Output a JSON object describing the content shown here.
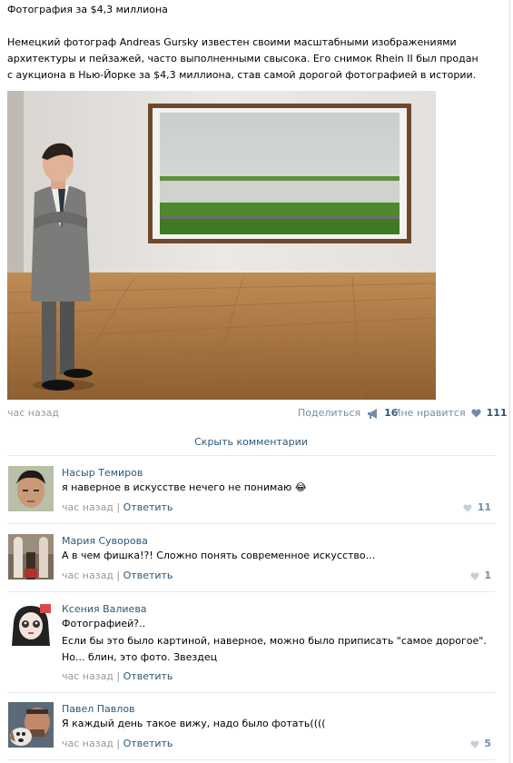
{
  "post": {
    "title": "Фотография за $4,3 миллиона",
    "text": "Немецкий фотограф Andreas Gursky известен своими масштабными изображениями архитектуры и пейзажей, часто выполненными свысока. Его снимок Rhein II был продан с аукциона в Нью-Йорке за $4,3 миллиона, став самой дорогой фотографией в истории.",
    "time": "час назад",
    "share_label": "Поделиться",
    "share_count": "16",
    "like_label": "Мне нравится",
    "like_count": "111",
    "hide_comments": "Скрыть комментарии"
  },
  "comments": [
    {
      "author": "Насыр Темиров",
      "text": "я наверное в искусстве нечего не понимаю",
      "emoji": "😂",
      "time": "час назад",
      "reply": "Ответить",
      "likes": "11"
    },
    {
      "author": "Мария Суворова",
      "text": "А в чем фишка!?! Сложно понять современное искусство...",
      "time": "час назад",
      "reply": "Ответить",
      "likes": "1"
    },
    {
      "author": "Ксения Валиева",
      "text_line1": "Фотографией?..",
      "text_line2": "Если бы это было картиной, наверное, можно было приписать \"самое дорогое\". Но... блин, это фото. Звездец",
      "time": "час назад",
      "reply": "Ответить"
    },
    {
      "author": "Павел Павлов",
      "text": "Я каждый день такое вижу, надо было фотать((((",
      "time": "час назад",
      "reply": "Ответить",
      "likes": "5"
    }
  ],
  "colors": {
    "link": "#2b587a",
    "muted": "#999999",
    "like_blue": "#728ea7"
  },
  "icons": {
    "share": "megaphone-icon",
    "like": "heart-icon"
  }
}
